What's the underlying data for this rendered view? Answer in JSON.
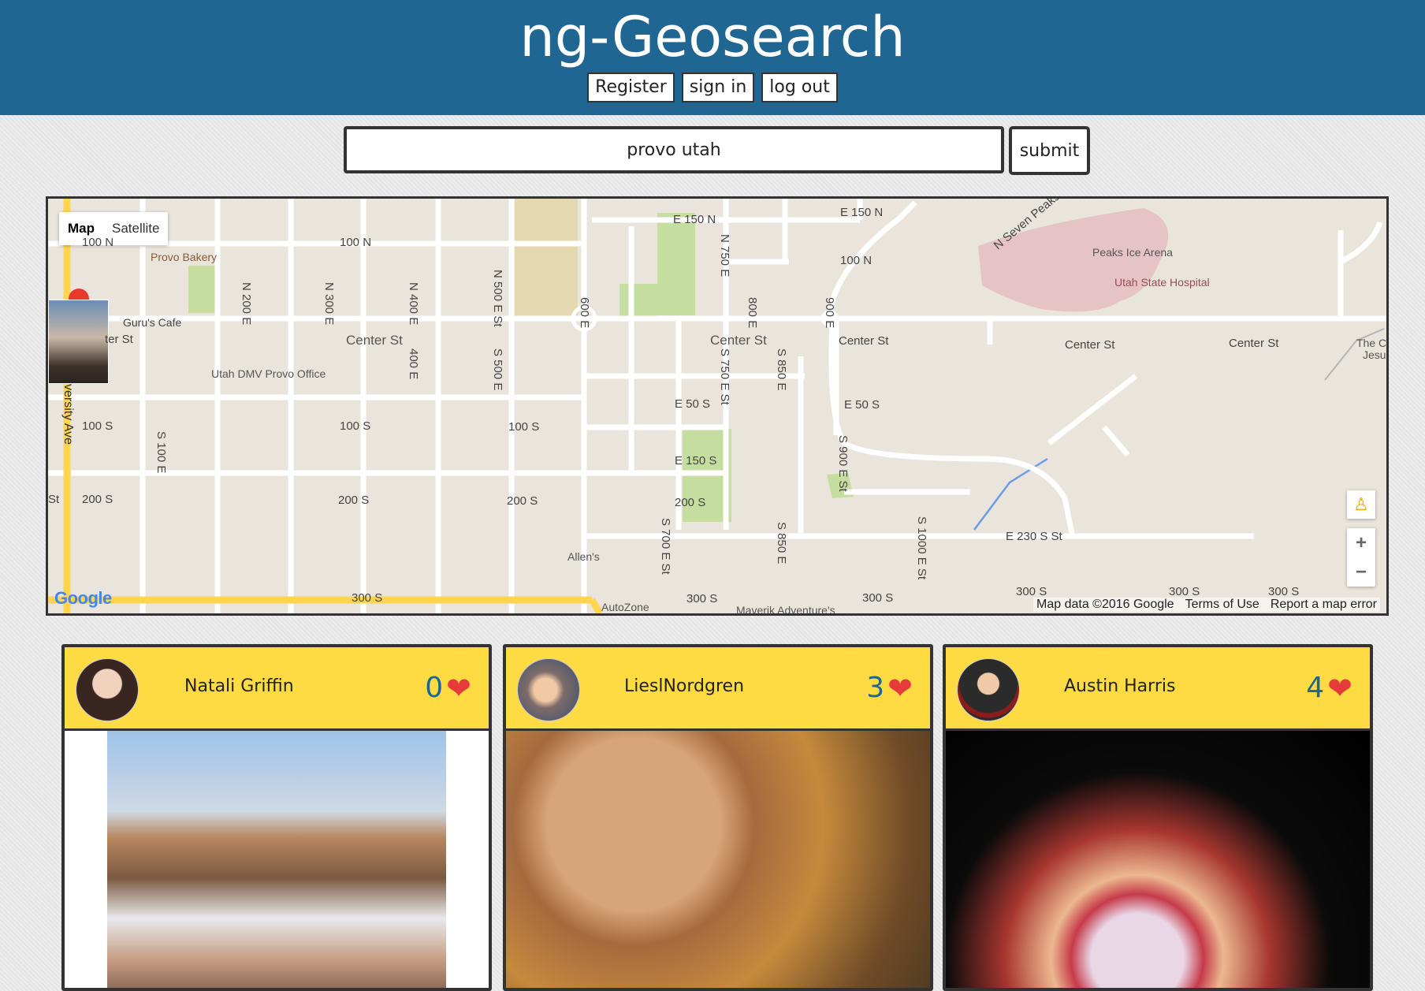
{
  "app": {
    "title": "ng-Geosearch",
    "nav": {
      "register": "Register",
      "sign_in": "sign in",
      "log_out": "log out"
    }
  },
  "search": {
    "value": "provo utah",
    "submit_label": "submit"
  },
  "map": {
    "type_controls": {
      "map": "Map",
      "satellite": "Satellite"
    },
    "labels": {
      "n100_left": "100 N",
      "n100_mid": "100 N",
      "n100_right": "100 N",
      "e150n_a": "E 150 N",
      "e150n_b": "E 150 N",
      "seven_peaks": "N Seven Peaks",
      "center_1": "Center St",
      "center_2": "Center St",
      "center_3": "Center St",
      "center_4": "Center St",
      "center_5": "Center St",
      "center_left": "ter St",
      "s100_a": "100 S",
      "s100_b": "100 S",
      "s100_c": "100 S",
      "s200_a": "200 S",
      "s200_b": "200 S",
      "s200_c": "200 S",
      "s200_d": "200 S",
      "s300_a": "300 S",
      "s300_b": "300 S",
      "s300_c": "300 S",
      "s300_d": "300 S",
      "s300_e": "300 S",
      "s300_f": "300 S",
      "st_left": "St",
      "e50s_a": "E 50 S",
      "e50s_b": "E 50 S",
      "e150s": "E 150 S",
      "e230s": "E 230 S St",
      "n200e": "N 200 E",
      "n300e": "N 300 E",
      "n400e": "N 400 E",
      "e400": "400 E",
      "n500e": "N 500 E St",
      "s500e": "S 500 E",
      "e600": "600 E",
      "n750e": "N 750 E",
      "e800": "800 E",
      "e900": "900 E",
      "s750e": "S 750 E St",
      "s850e": "S 850 E",
      "s850e_b": "S 850 E",
      "s900e": "S 900 E St",
      "s700e": "S 700 E St",
      "s1000e": "S 1000 E St",
      "s100e": "S 100 E",
      "university": "versity Ave"
    },
    "pois": {
      "provo_bakery": "Provo Bakery",
      "gurus_cafe": "Guru's Cafe",
      "utah_dmv": "Utah DMV Provo Office",
      "peaks_ice": "Peaks Ice Arena",
      "state_hospital": "Utah State Hospital",
      "allens": "Allen's",
      "autozone": "AutoZone",
      "maverik": "Maverik Adventure's",
      "the_church": "The Ch",
      "jesus": "Jesus"
    },
    "google_logo": "Google",
    "attribution": {
      "data": "Map data ©2016 Google",
      "terms": "Terms of Use",
      "report": "Report a map error"
    }
  },
  "posts": [
    {
      "user": "Natali Griffin",
      "likes": "0"
    },
    {
      "user": "LieslNordgren",
      "likes": "3"
    },
    {
      "user": "Austin Harris",
      "likes": "4"
    }
  ],
  "colors": {
    "header": "#1f6693",
    "card_header": "#fedb43",
    "heart": "#e53b3b",
    "like_count": "#1f6693"
  },
  "icons": {
    "heart": "heart-icon",
    "pegman": "pegman-icon",
    "zoom_in": "zoom-in-icon",
    "zoom_out": "zoom-out-icon"
  }
}
